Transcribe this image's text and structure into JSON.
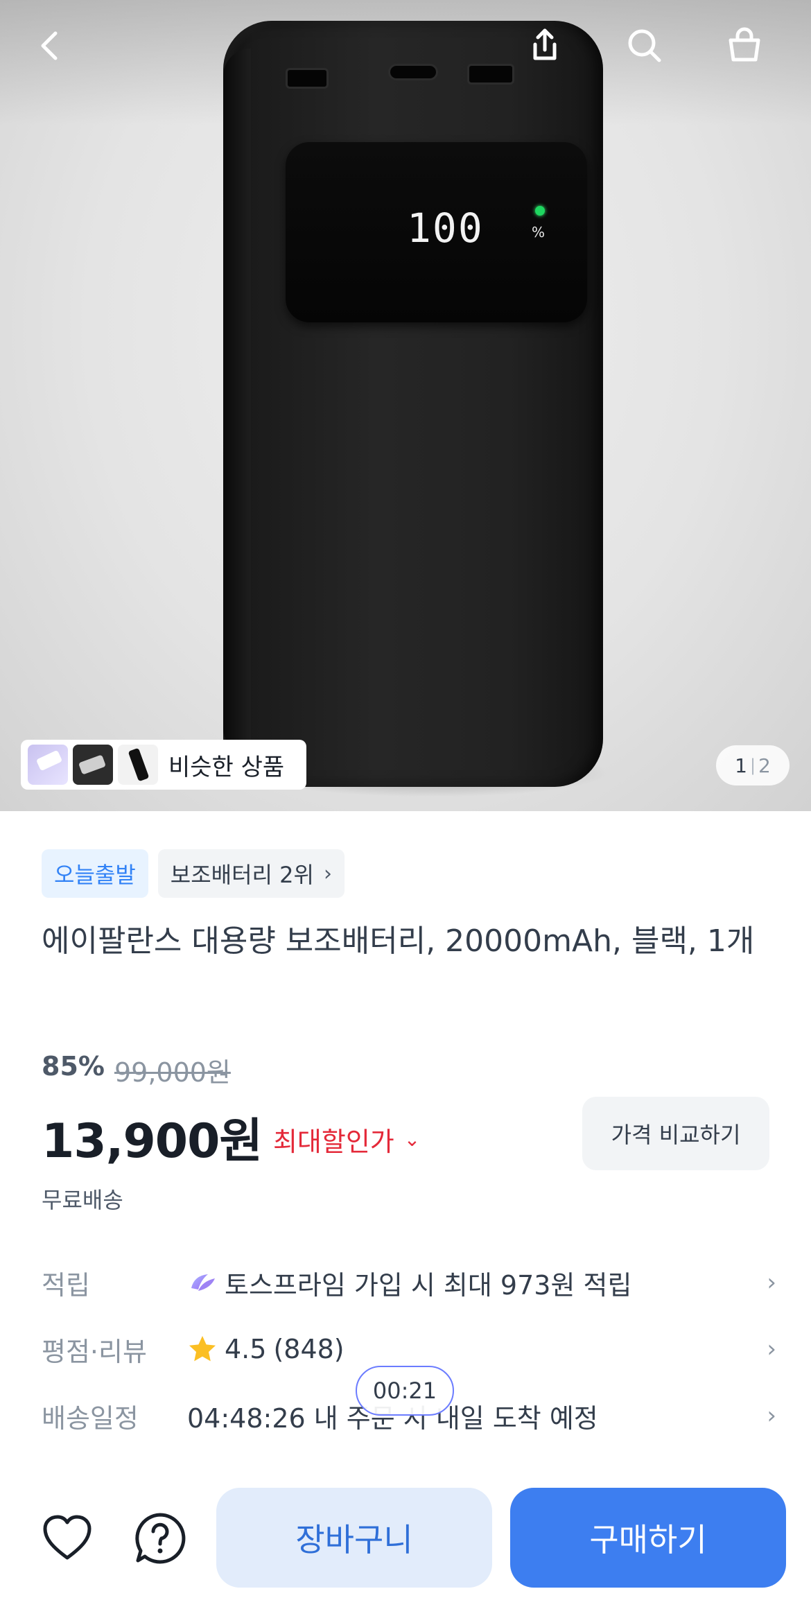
{
  "hero": {
    "display_digits": "100",
    "display_unit": "%",
    "similar_label": "비슷한 상품",
    "pager": {
      "current": "1",
      "separator": "|",
      "total": "2"
    },
    "nav_icons": [
      "back-icon",
      "share-icon",
      "search-icon",
      "cart-bag-icon"
    ]
  },
  "product": {
    "tags": {
      "delivery": "오늘출발",
      "rank": "보조배터리 2위",
      "rank_chevron": "›"
    },
    "title": "에이팔란스 대용량 보조배터리, 20000mAh, 블랙, 1개",
    "discount_rate": "85%",
    "original_price": "99,000원",
    "price": "13,900원",
    "max_discount": "최대할인가",
    "max_discount_chevron": "⌄",
    "compare_button": "가격 비교하기",
    "shipping": "무료배송"
  },
  "info_rows": {
    "points": {
      "label": "적립",
      "value": "토스프라임 가입 시 최대 973원 적립",
      "arrow": "›"
    },
    "rating": {
      "label": "평점·리뷰",
      "score": "4.5",
      "count": "(848)",
      "arrow": "›"
    },
    "delivery": {
      "label": "배송일정",
      "value": "04:48:26 내 주문 시 내일 도착 예정",
      "arrow": "›"
    }
  },
  "timer_overlay": "00:21",
  "bottom_bar": {
    "cart_button": "장바구니",
    "buy_button": "구매하기"
  },
  "colors": {
    "accent_blue": "#3182f6",
    "discount_red": "#e42939",
    "buy_button": "#3d7ef0",
    "cart_button_bg": "#e2ecfb",
    "star": "#fbbf24"
  }
}
